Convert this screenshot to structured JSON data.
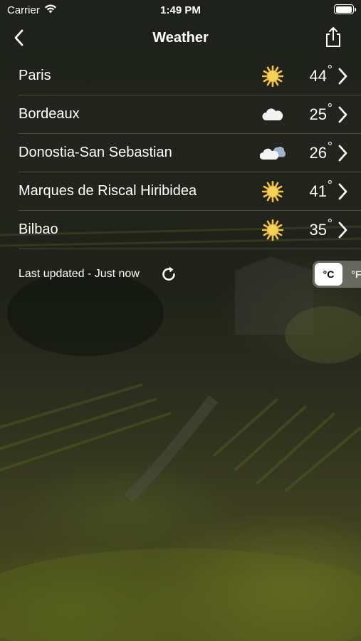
{
  "status_bar": {
    "carrier": "Carrier",
    "time": "1:49 PM",
    "battery_level": 1.0
  },
  "nav": {
    "title": "Weather",
    "back_icon": "chevron-left-icon",
    "share_icon": "share-icon"
  },
  "cities": [
    {
      "name": "Paris",
      "icon": "sun-icon",
      "temp": "44",
      "deg": "°"
    },
    {
      "name": "Bordeaux",
      "icon": "cloud-icon",
      "temp": "25",
      "deg": "°"
    },
    {
      "name": "Donostia-San Sebastian",
      "icon": "partly-cloudy-icon",
      "temp": "26",
      "deg": "°"
    },
    {
      "name": "Marques de Riscal Hiribidea",
      "icon": "sun-icon",
      "temp": "41",
      "deg": "°"
    },
    {
      "name": "Bilbao",
      "icon": "sun-icon",
      "temp": "35",
      "deg": "°"
    }
  ],
  "footer": {
    "last_updated": "Last updated - Just now",
    "refresh_icon": "refresh-icon",
    "units": {
      "celsius": "°C",
      "fahrenheit": "°F",
      "selected": "°C"
    }
  },
  "colors": {
    "sun": "#f5c542",
    "text": "#ffffff"
  }
}
